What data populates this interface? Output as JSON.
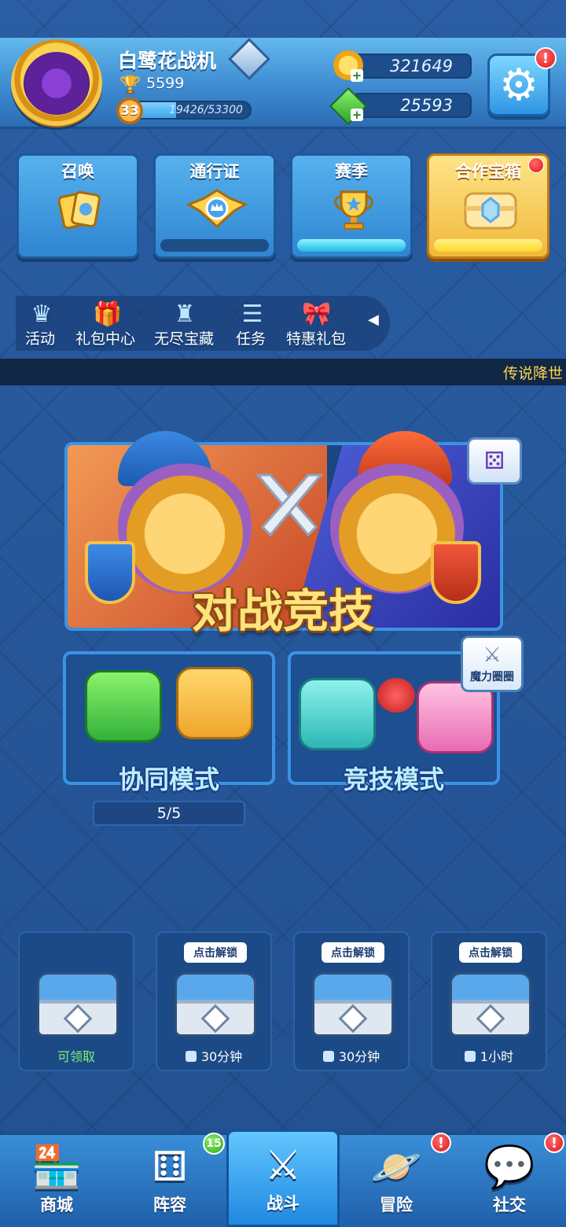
{
  "player": {
    "name": "白鹭花战机",
    "trophies": "5599",
    "level": "33",
    "xp_text": "19426/53300",
    "xp_progress": 0.364
  },
  "currency": {
    "coins": "321649",
    "gems": "25593"
  },
  "settings": {
    "badge": "!"
  },
  "cards": [
    {
      "title": "召唤",
      "icon": "cards-icon"
    },
    {
      "title": "通行证",
      "icon": "crown-badge-icon",
      "progress": 0
    },
    {
      "title": "赛季",
      "icon": "trophy-icon",
      "progress": 1.0
    },
    {
      "title": "合作宝箱",
      "icon": "chest-icon",
      "progress": 1.0
    }
  ],
  "shortcuts": [
    {
      "label": "活动",
      "icon": "crown-icon"
    },
    {
      "label": "礼包中心",
      "icon": "gift-icon"
    },
    {
      "label": "无尽宝藏",
      "icon": "treasure-icon"
    },
    {
      "label": "任务",
      "icon": "task-list-icon"
    },
    {
      "label": "特惠礼包",
      "icon": "bow-gift-icon"
    }
  ],
  "ticker": "传说降世",
  "battle": {
    "title": "对战竞技"
  },
  "modes": {
    "coop": {
      "title": "协同模式",
      "progress": "5/5"
    },
    "pvp": {
      "title": "竞技模式",
      "badge": "魔力圈圈"
    }
  },
  "chests": [
    {
      "status": "可领取",
      "tip": ""
    },
    {
      "status": "30分钟",
      "tip": "点击解锁"
    },
    {
      "status": "30分钟",
      "tip": "点击解锁"
    },
    {
      "status": "1小时",
      "tip": "点击解锁"
    }
  ],
  "nav": [
    {
      "label": "商城",
      "icon": "shop-icon"
    },
    {
      "label": "阵容",
      "icon": "dice-icon",
      "badge": "15"
    },
    {
      "label": "战斗",
      "icon": "crossed-swords-icon",
      "active": true
    },
    {
      "label": "冒险",
      "icon": "planet-icon",
      "badge": "!"
    },
    {
      "label": "社交",
      "icon": "chat-icon",
      "badge": "!"
    }
  ],
  "colors": {
    "accent": "#2f85d0",
    "gold": "#f0b93c",
    "alert": "#e1141b",
    "positive": "#7ef27a"
  }
}
